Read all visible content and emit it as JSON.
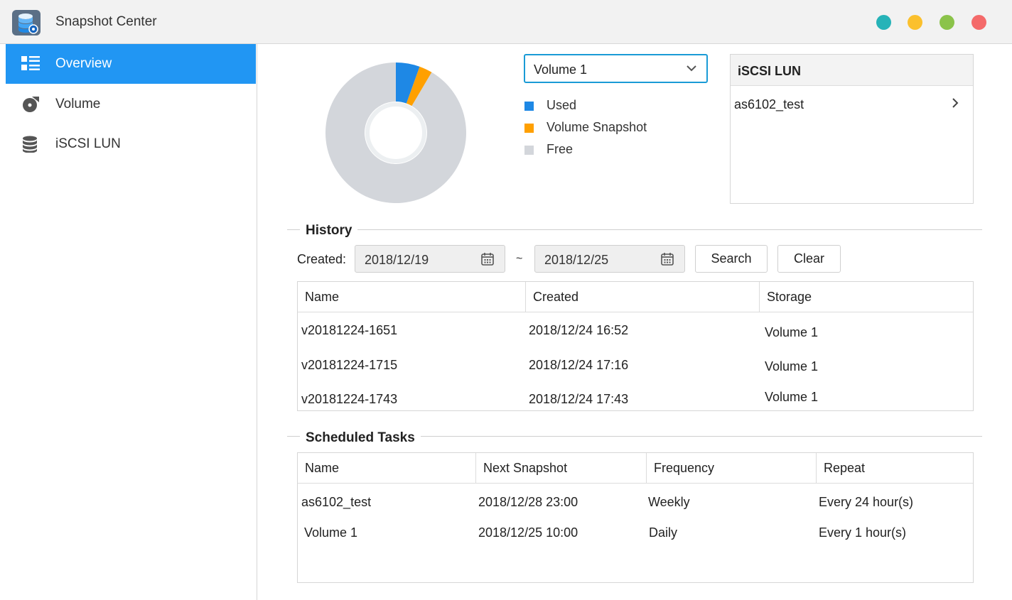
{
  "app": {
    "title": "Snapshot Center",
    "icon": "database-snapshot-icon",
    "window_dots": [
      {
        "name": "teal-dot",
        "color": "#26b3b8"
      },
      {
        "name": "yellow-dot",
        "color": "#fbc02d"
      },
      {
        "name": "green-dot",
        "color": "#8bc34a"
      },
      {
        "name": "red-dot",
        "color": "#f46a6a"
      }
    ]
  },
  "sidebar": {
    "items": [
      {
        "label": "Overview",
        "icon": "list-overview-icon",
        "active": true
      },
      {
        "label": "Volume",
        "icon": "disk-volume-icon",
        "active": false
      },
      {
        "label": "iSCSI LUN",
        "icon": "database-stack-icon",
        "active": false
      }
    ]
  },
  "overview": {
    "volume_select": {
      "value": "Volume 1"
    },
    "usage_chart": {
      "used_fraction": 0.055,
      "snapshot_fraction": 0.03,
      "free_fraction": 0.915
    },
    "legend": [
      {
        "label": "Used",
        "color": "#1e88e5"
      },
      {
        "label": "Volume Snapshot",
        "color": "#ffa000"
      },
      {
        "label": "Free",
        "color": "#d3d6db"
      }
    ],
    "iscsi_panel": {
      "title": "iSCSI LUN",
      "items": [
        "as6102_test"
      ]
    }
  },
  "history": {
    "title": "History",
    "created_label": "Created:",
    "date_from": "2018/12/19",
    "tilde": "~",
    "date_to": "2018/12/25",
    "search_label": "Search",
    "clear_label": "Clear",
    "columns": [
      "Name",
      "Created",
      "Storage"
    ],
    "rows": [
      [
        "v20181224-1651",
        "2018/12/24 16:52",
        "Volume 1"
      ],
      [
        "v20181224-1715",
        "2018/12/24 17:16",
        "Volume 1"
      ],
      [
        "v20181224-1743",
        "2018/12/24 17:43",
        "Volume 1"
      ]
    ]
  },
  "scheduled": {
    "title": "Scheduled Tasks",
    "columns": [
      "Name",
      "Next Snapshot",
      "Frequency",
      "Repeat"
    ],
    "rows": [
      [
        "as6102_test",
        "2018/12/28 23:00",
        "Weekly",
        "Every 24 hour(s)"
      ],
      [
        "Volume 1",
        "2018/12/25 10:00",
        "Daily",
        "Every 1 hour(s)"
      ]
    ]
  }
}
